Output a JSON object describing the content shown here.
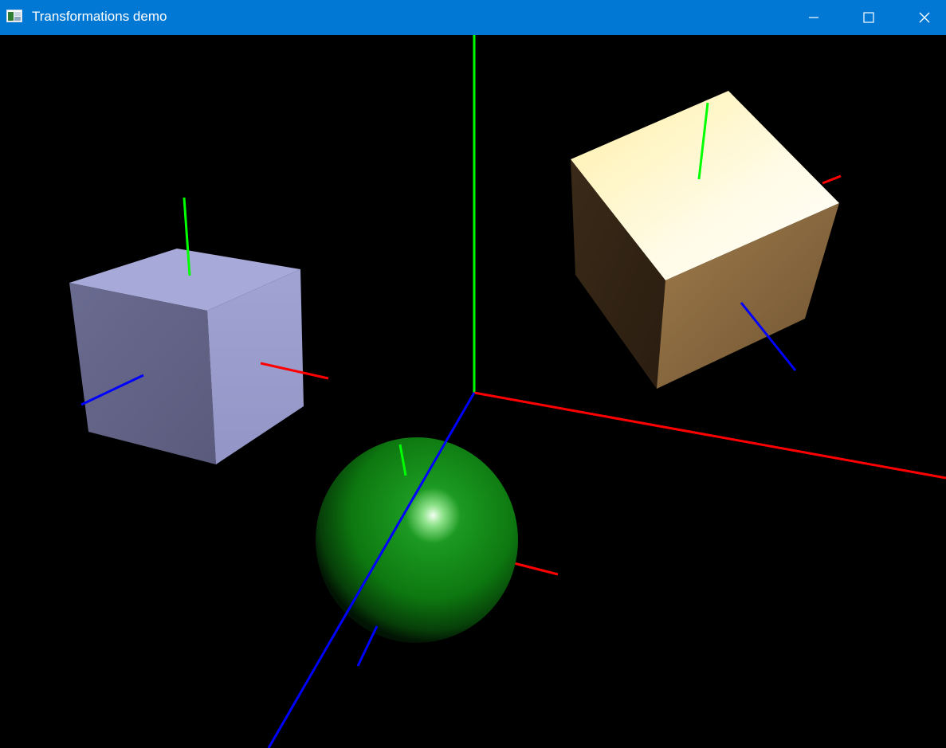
{
  "window": {
    "title": "Transformations demo",
    "background": "#000000",
    "titlebar_color": "#0078d4"
  },
  "titlebar": {
    "icons": [
      "app-icon",
      "minimize-icon",
      "maximize-icon",
      "close-icon"
    ]
  },
  "scene": {
    "axis_colors": {
      "x": "#ff0000",
      "y": "#00ff00",
      "z": "#0000ff"
    },
    "objects": [
      {
        "name": "left-cube",
        "type": "cube",
        "color": "#9a9cd6"
      },
      {
        "name": "right-cube",
        "type": "cube",
        "color": "#fff6c8"
      },
      {
        "name": "sphere",
        "type": "sphere",
        "color": "#0e8a12"
      }
    ]
  }
}
